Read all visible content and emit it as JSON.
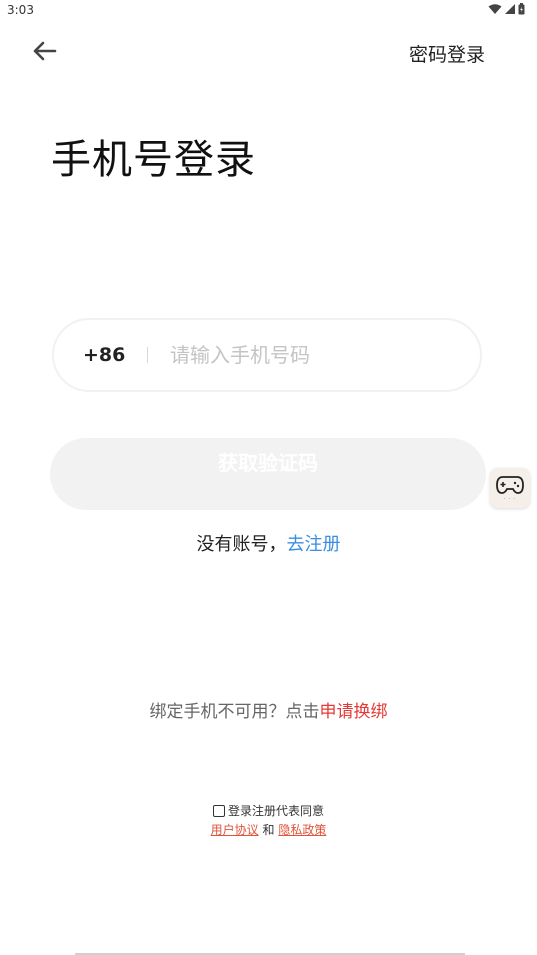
{
  "status_bar": {
    "time": "3:03"
  },
  "header": {
    "password_login": "密码登录"
  },
  "title": "手机号登录",
  "phone": {
    "country_code": "+86",
    "placeholder": "请输入手机号码"
  },
  "get_code_button": "获取验证码",
  "register": {
    "prefix": "没有账号，",
    "link": "去注册"
  },
  "rebind": {
    "prefix": "绑定手机不可用？点击",
    "link": "申请换绑"
  },
  "agreement": {
    "prefix": "登录注册代表同意",
    "user_agreement": "用户协议",
    "and": "和",
    "privacy_policy": "隐私政策"
  },
  "icons": {
    "back": "arrow-left-icon",
    "widget": "gamepad-icon"
  },
  "colors": {
    "link_blue": "#3a8ee6",
    "link_red": "#e53935",
    "agreement_link": "#e0533a",
    "button_bg": "#f2f2f2"
  }
}
